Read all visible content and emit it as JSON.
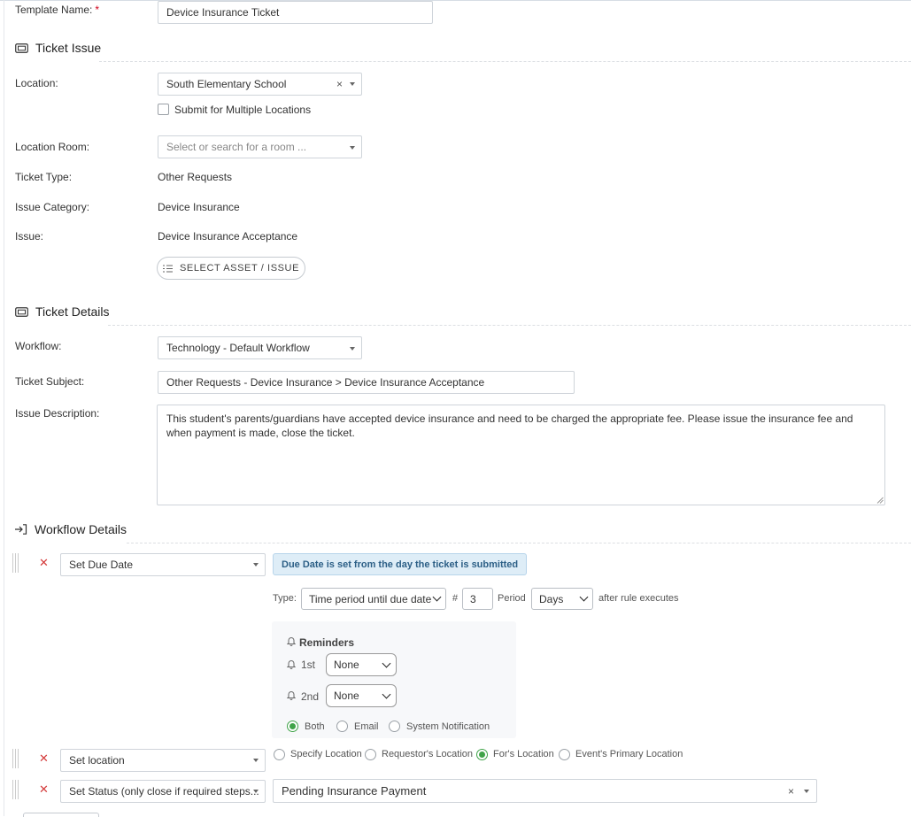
{
  "form": {
    "template_name_label": "Template Name:",
    "required_mark": "*",
    "template_name_value": "Device Insurance Ticket"
  },
  "ticket_issue": {
    "title": "Ticket Issue",
    "location_label": "Location:",
    "location_value": "South Elementary School",
    "clear_symbol": "×",
    "multi_location_label": "Submit for Multiple Locations",
    "room_label": "Location Room:",
    "room_placeholder": "Select or search for a room ...",
    "ticket_type_label": "Ticket Type:",
    "ticket_type_value": "Other Requests",
    "issue_category_label": "Issue Category:",
    "issue_category_value": "Device Insurance",
    "issue_label": "Issue:",
    "issue_value": "Device Insurance Acceptance",
    "select_asset_button": "SELECT ASSET / ISSUE"
  },
  "ticket_details": {
    "title": "Ticket Details",
    "workflow_label": "Workflow:",
    "workflow_value": "Technology - Default Workflow",
    "subject_label": "Ticket Subject:",
    "subject_value": "Other Requests - Device Insurance > Device Insurance Acceptance",
    "description_label": "Issue Description:",
    "description_value": "This student's parents/guardians have accepted device insurance and need to be charged the appropriate fee. Please issue the insurance fee and when payment is made, close the ticket."
  },
  "workflow_details": {
    "title": "Workflow Details",
    "rules": [
      {
        "action": "Set Due Date",
        "badge": "Due Date is set from the day the ticket is submitted",
        "type_label": "Type:",
        "type_value": "Time period until due date",
        "hash_label": "#",
        "count_value": "3",
        "period_label": "Period",
        "period_value": "Days",
        "after_label": "after rule executes",
        "reminders_title": "Reminders",
        "reminder_1_label": "1st",
        "reminder_1_value": "None",
        "reminder_2_label": "2nd",
        "reminder_2_value": "None",
        "notify_options": [
          "Both",
          "Email",
          "System Notification"
        ],
        "notify_selected": "Both"
      },
      {
        "action": "Set location",
        "location_options": [
          "Specify Location",
          "Requestor's Location",
          "For's Location",
          "Event's Primary Location"
        ],
        "location_selected": "For's Location"
      },
      {
        "action": "Set Status (only close if required steps...",
        "status_value": "Pending Insurance Payment"
      }
    ]
  },
  "colors": {
    "accent_green": "#3fa348",
    "delete_red": "#d43b3b",
    "badge_bg": "#deedf7",
    "badge_text": "#2c5f86"
  }
}
